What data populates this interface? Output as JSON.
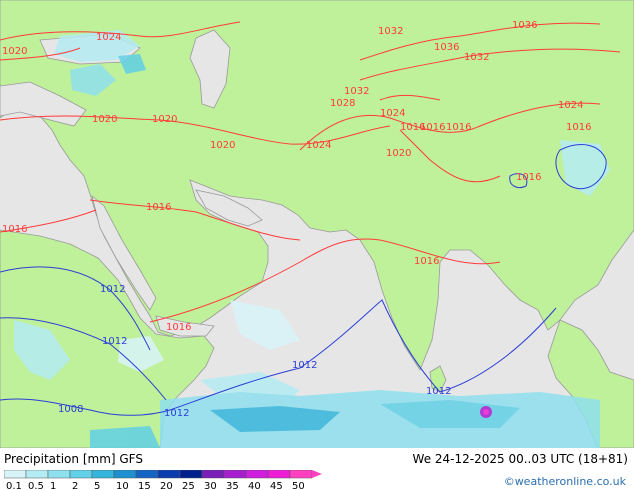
{
  "map": {
    "isobar_labels_red": [
      "1020",
      "1024",
      "1020",
      "1020",
      "1020",
      "1016",
      "1016",
      "1016",
      "1016",
      "1016",
      "1032",
      "1036",
      "1036",
      "1032",
      "1032",
      "1028",
      "1024",
      "1024",
      "1020",
      "1016",
      "1016",
      "1016",
      "1016",
      "1024"
    ],
    "isobar_labels_blue": [
      "1012",
      "1012",
      "1012",
      "1008",
      "1012",
      "1012"
    ],
    "colors": {
      "land": "#bff09a",
      "sea": "#e6e6e6",
      "isobar_high": "#ff3b3b",
      "isobar_low": "#2b3fd6",
      "border": "#999999"
    }
  },
  "legend": {
    "title": "Precipitation [mm]  GFS",
    "datetime": "We 24-12-2025 00..03 UTC (18+81)",
    "credit": "©weatheronline.co.uk",
    "scale_labels": [
      "0.1",
      "0.5",
      "1",
      "2",
      "5",
      "10",
      "15",
      "20",
      "25",
      "30",
      "35",
      "40",
      "45",
      "50"
    ],
    "scale_colors": [
      "#d8f4f8",
      "#b4ecf4",
      "#8ee0ee",
      "#62d0e6",
      "#34b6dc",
      "#1e90d0",
      "#1464c4",
      "#0a3cb0",
      "#00208e",
      "#7a1eb8",
      "#a61ed0",
      "#d01ee0",
      "#ee1ed6",
      "#ff40c0"
    ]
  }
}
